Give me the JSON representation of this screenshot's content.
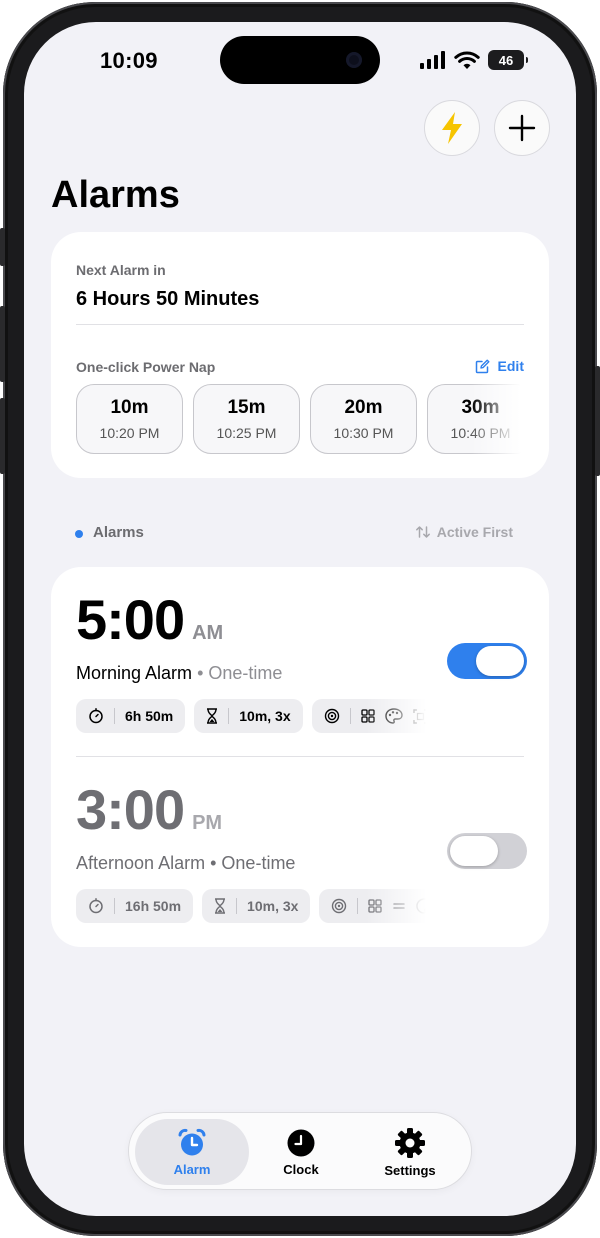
{
  "status_bar": {
    "time": "10:09",
    "battery": "46"
  },
  "header": {
    "title": "Alarms"
  },
  "next_alarm": {
    "label": "Next Alarm in",
    "value": "6 Hours 50 Minutes",
    "power_nap_label": "One-click Power Nap",
    "edit_label": "Edit",
    "naps": [
      {
        "duration": "10m",
        "time": "10:20 PM"
      },
      {
        "duration": "15m",
        "time": "10:25 PM"
      },
      {
        "duration": "20m",
        "time": "10:30 PM"
      },
      {
        "duration": "30m",
        "time": "10:40 PM"
      }
    ]
  },
  "alarms_section": {
    "title": "Alarms",
    "sort_label": "Active First"
  },
  "alarms": [
    {
      "time": "5:00",
      "ampm": "AM",
      "name": "Morning Alarm",
      "repeat": "One-time",
      "enabled": true,
      "countdown": "6h 50m",
      "snooze": "10m, 3x"
    },
    {
      "time": "3:00",
      "ampm": "PM",
      "name": "Afternoon Alarm",
      "repeat": "One-time",
      "enabled": false,
      "countdown": "16h 50m",
      "snooze": "10m, 3x"
    }
  ],
  "tabbar": {
    "tabs": [
      {
        "label": "Alarm",
        "icon": "alarm-clock-icon",
        "active": true
      },
      {
        "label": "Clock",
        "icon": "clock-icon",
        "active": false
      },
      {
        "label": "Settings",
        "icon": "gear-icon",
        "active": false
      }
    ]
  },
  "colors": {
    "accent": "#2f80ed",
    "background": "#f2f2f7",
    "card": "#ffffff",
    "power_nap_icon": "#f6c400",
    "toggle_off": "#d1d1d6"
  },
  "separator": "•",
  "separator_glyph": "·"
}
